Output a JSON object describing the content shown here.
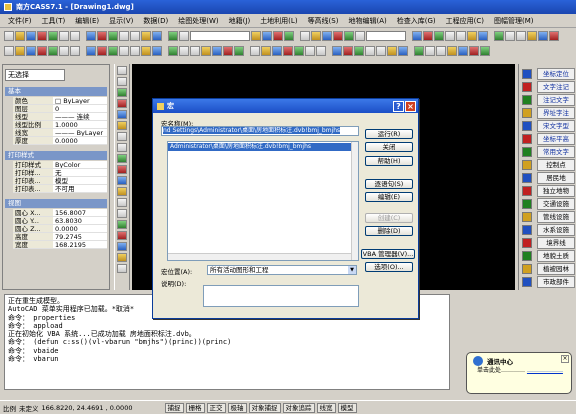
{
  "window": {
    "title": "南方CASS7.1 - [Drawing1.dwg]"
  },
  "menu": [
    "文件(F)",
    "工具(T)",
    "编辑(E)",
    "显示(V)",
    "数据(D)",
    "绘图处理(W)",
    "地籍(J)",
    "土地利用(L)",
    "等高线(S)",
    "地物编辑(A)",
    "检查入库(G)",
    "工程应用(C)",
    "图幅管理(M)"
  ],
  "properties": {
    "selector": "无选择",
    "sections": [
      {
        "label": "基本",
        "rows": [
          {
            "k": "颜色",
            "v": "□ ByLayer"
          },
          {
            "k": "图层",
            "v": "0"
          },
          {
            "k": "线型",
            "v": "——— 连续"
          },
          {
            "k": "线型比例",
            "v": "1.0000"
          },
          {
            "k": "线宽",
            "v": "——— ByLayer"
          },
          {
            "k": "厚度",
            "v": "0.0000"
          }
        ]
      },
      {
        "label": "打印样式",
        "rows": [
          {
            "k": "打印样式",
            "v": "ByColor"
          },
          {
            "k": "打印样...",
            "v": "无"
          },
          {
            "k": "打印表...",
            "v": "模型"
          },
          {
            "k": "打印表...",
            "v": "不可用"
          }
        ]
      },
      {
        "label": "视图",
        "rows": [
          {
            "k": "圆心 X...",
            "v": "156.8007"
          },
          {
            "k": "圆心 Y...",
            "v": "63.8030"
          },
          {
            "k": "圆心 Z...",
            "v": "0.0000"
          },
          {
            "k": "高度",
            "v": "79.2745"
          },
          {
            "k": "宽度",
            "v": "168.2195"
          }
        ]
      }
    ]
  },
  "right_panel": [
    "坐标定位",
    "文字注记",
    "注记文字",
    "界址字注",
    "宋文字型",
    "坐标平高",
    "常用文字",
    "控制点",
    "居民地",
    "独立地物",
    "交通设施",
    "管线设施",
    "水系设施",
    "境界线",
    "地貌土质",
    "植被园林",
    "市政部件"
  ],
  "dialog": {
    "title": "宏",
    "name_label": "宏名称(M):",
    "name_value": "nd Settings\\Administrator\\桌面\\房地面积标注.dvb!bmj_bmjhs",
    "list_items": [
      "Administrator\\桌面\\房地面积标注.dvb!bmj_bmjhs"
    ],
    "buttons": [
      "运行(R)",
      "关闭",
      "帮助(H)",
      "逐语句(S)",
      "编辑(E)",
      "创建(C)",
      "删除(D)",
      "VBA 管理器(V)...",
      "选项(O)..."
    ],
    "disabled": [
      false,
      false,
      false,
      false,
      false,
      true,
      false,
      false,
      false
    ],
    "location_label": "宏位置(A):",
    "location_value": "所有活动图形和工程",
    "desc_label": "说明(D):"
  },
  "command_lines": [
    "正在重生成模型。",
    "AutoCAD 菜单实用程序已加载。*取消*",
    "命令： properties",
    "命令： appload",
    "正在初始化 VBA 系统...已成功加载 房地面积标注.dvb。",
    "命令： (defun c:ss()(vl-vbarun \"bmjhs\")(princ))(princ)",
    "命令： vbaide",
    "命令： vbarun"
  ],
  "status": {
    "scale": "比例",
    "scale_value": "未定义",
    "coords": "166.8220, 24.4691 , 0.0000",
    "toggles": [
      "捕捉",
      "栅格",
      "正交",
      "极轴",
      "对象捕捉",
      "对象追踪",
      "线宽",
      "模型"
    ]
  },
  "balloon": {
    "title": "通讯中心",
    "text": "单击此处…………",
    "link": "………………"
  }
}
